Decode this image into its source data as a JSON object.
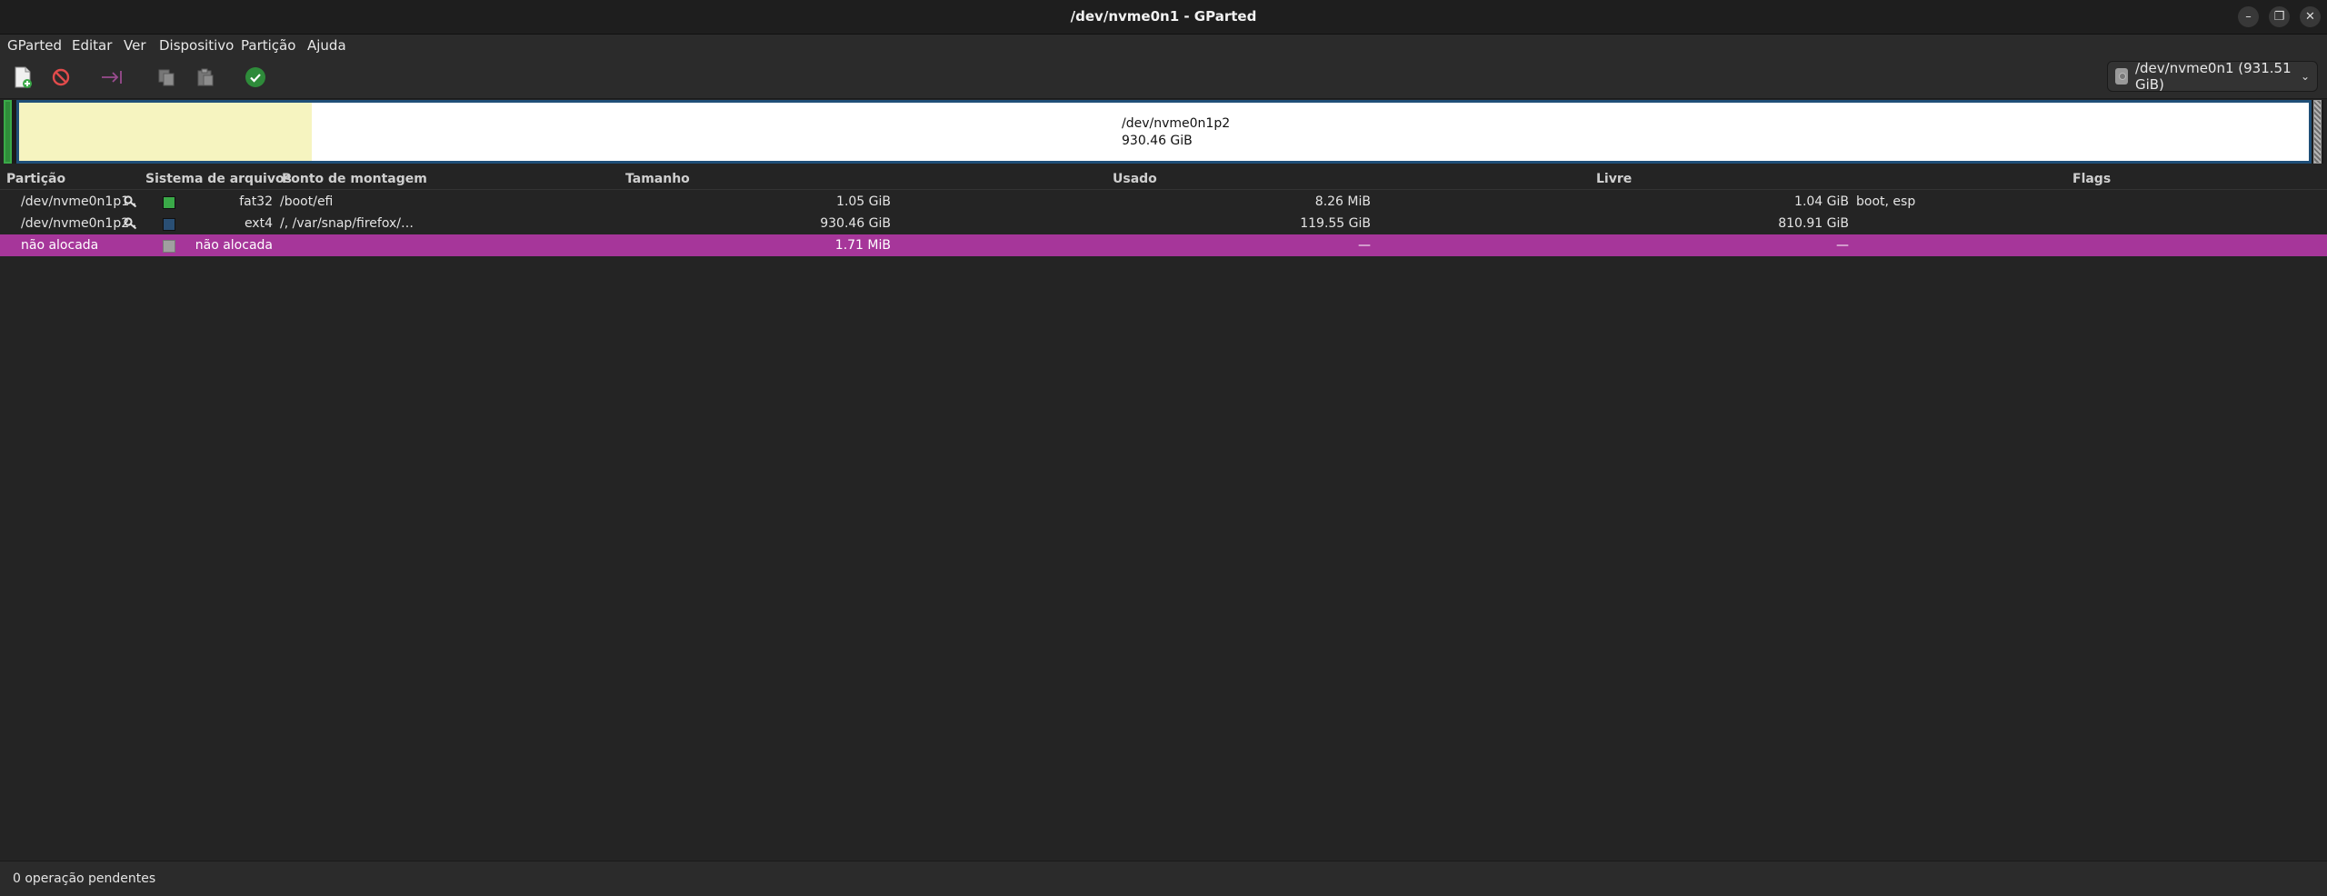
{
  "window": {
    "title": "/dev/nvme0n1 - GParted",
    "minimize_icon": "minimize-icon",
    "maximize_icon": "restore-icon",
    "close_icon": "close-icon"
  },
  "menu": {
    "items": [
      "GParted",
      "Editar",
      "Ver",
      "Dispositivo",
      "Partição",
      "Ajuda"
    ]
  },
  "toolbar": {
    "buttons": [
      {
        "icon": "new-partition-icon"
      },
      {
        "icon": "delete-icon"
      },
      {
        "icon": "resize-move-icon"
      },
      {
        "icon": "copy-icon"
      },
      {
        "icon": "paste-icon"
      },
      {
        "icon": "apply-icon"
      }
    ],
    "device_selector": {
      "icon": "disk-icon",
      "value": "/dev/nvme0n1 (931.51 GiB)"
    }
  },
  "disk_map": {
    "main_label_name": "/dev/nvme0n1p2",
    "main_label_size": "930.46 GiB",
    "colors": {
      "fat32": "#3aa948",
      "ext4": "#1f4f78",
      "used": "#f6f4c0",
      "unallocated": "#a0a0a0"
    }
  },
  "table": {
    "headers": [
      "Partição",
      "Sistema de arquivos",
      "Ponto de montagem",
      "Tamanho",
      "Usado",
      "Livre",
      "Flags"
    ],
    "rows": [
      {
        "partition": "/dev/nvme0n1p1",
        "mounted": true,
        "fs_color": "#3aa948",
        "filesystem": "fat32",
        "mountpoint": "/boot/efi",
        "size": "1.05 GiB",
        "used": "8.26 MiB",
        "free": "1.04 GiB",
        "flags": "boot, esp"
      },
      {
        "partition": "/dev/nvme0n1p2",
        "mounted": true,
        "fs_color": "#2a4f74",
        "filesystem": "ext4",
        "mountpoint": "/, /var/snap/firefox/…",
        "size": "930.46 GiB",
        "used": "119.55 GiB",
        "free": "810.91 GiB",
        "flags": ""
      },
      {
        "partition": "não alocada",
        "mounted": false,
        "fs_color": "#a0a0a0",
        "filesystem": "não alocada",
        "mountpoint": "",
        "size": "1.71 MiB",
        "used": "—",
        "free": "—",
        "flags": ""
      }
    ]
  },
  "status": {
    "text": "0 operação pendentes"
  }
}
